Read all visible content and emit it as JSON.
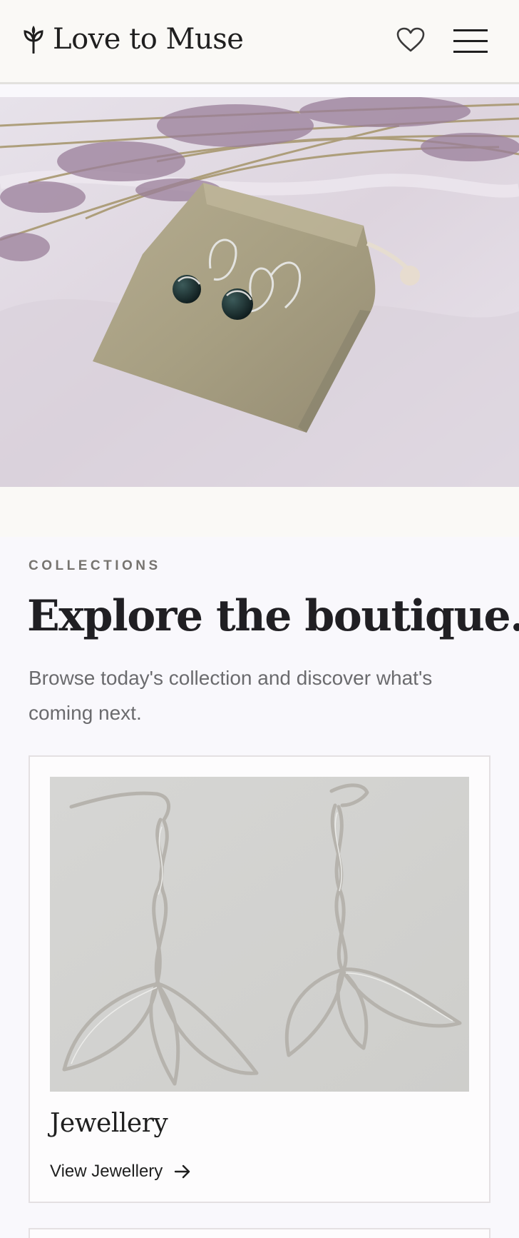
{
  "header": {
    "brand": "Love to Muse",
    "icons": {
      "logo": "sprout-icon",
      "favorite": "heart-icon",
      "menu": "hamburger-menu-icon"
    }
  },
  "hero": {
    "image": "hero-image-earrings-on-linen-pouch"
  },
  "collections": {
    "eyebrow": "COLLECTIONS",
    "headline": "Explore the boutique.",
    "intro": "Browse today's collection and discover what's coming next.",
    "cards": [
      {
        "title": "Jewellery",
        "link_label": "View Jewellery",
        "image": "silver-leaf-earrings-photo",
        "link_icon": "arrow-right-icon"
      }
    ]
  },
  "colors": {
    "header_bg": "#faf9f6",
    "page_bg": "#f9f8fc",
    "text_dark": "#201f23",
    "eyebrow": "#76736f",
    "muted_text": "#6b6b6e",
    "card_border": "#e4e0e2"
  }
}
